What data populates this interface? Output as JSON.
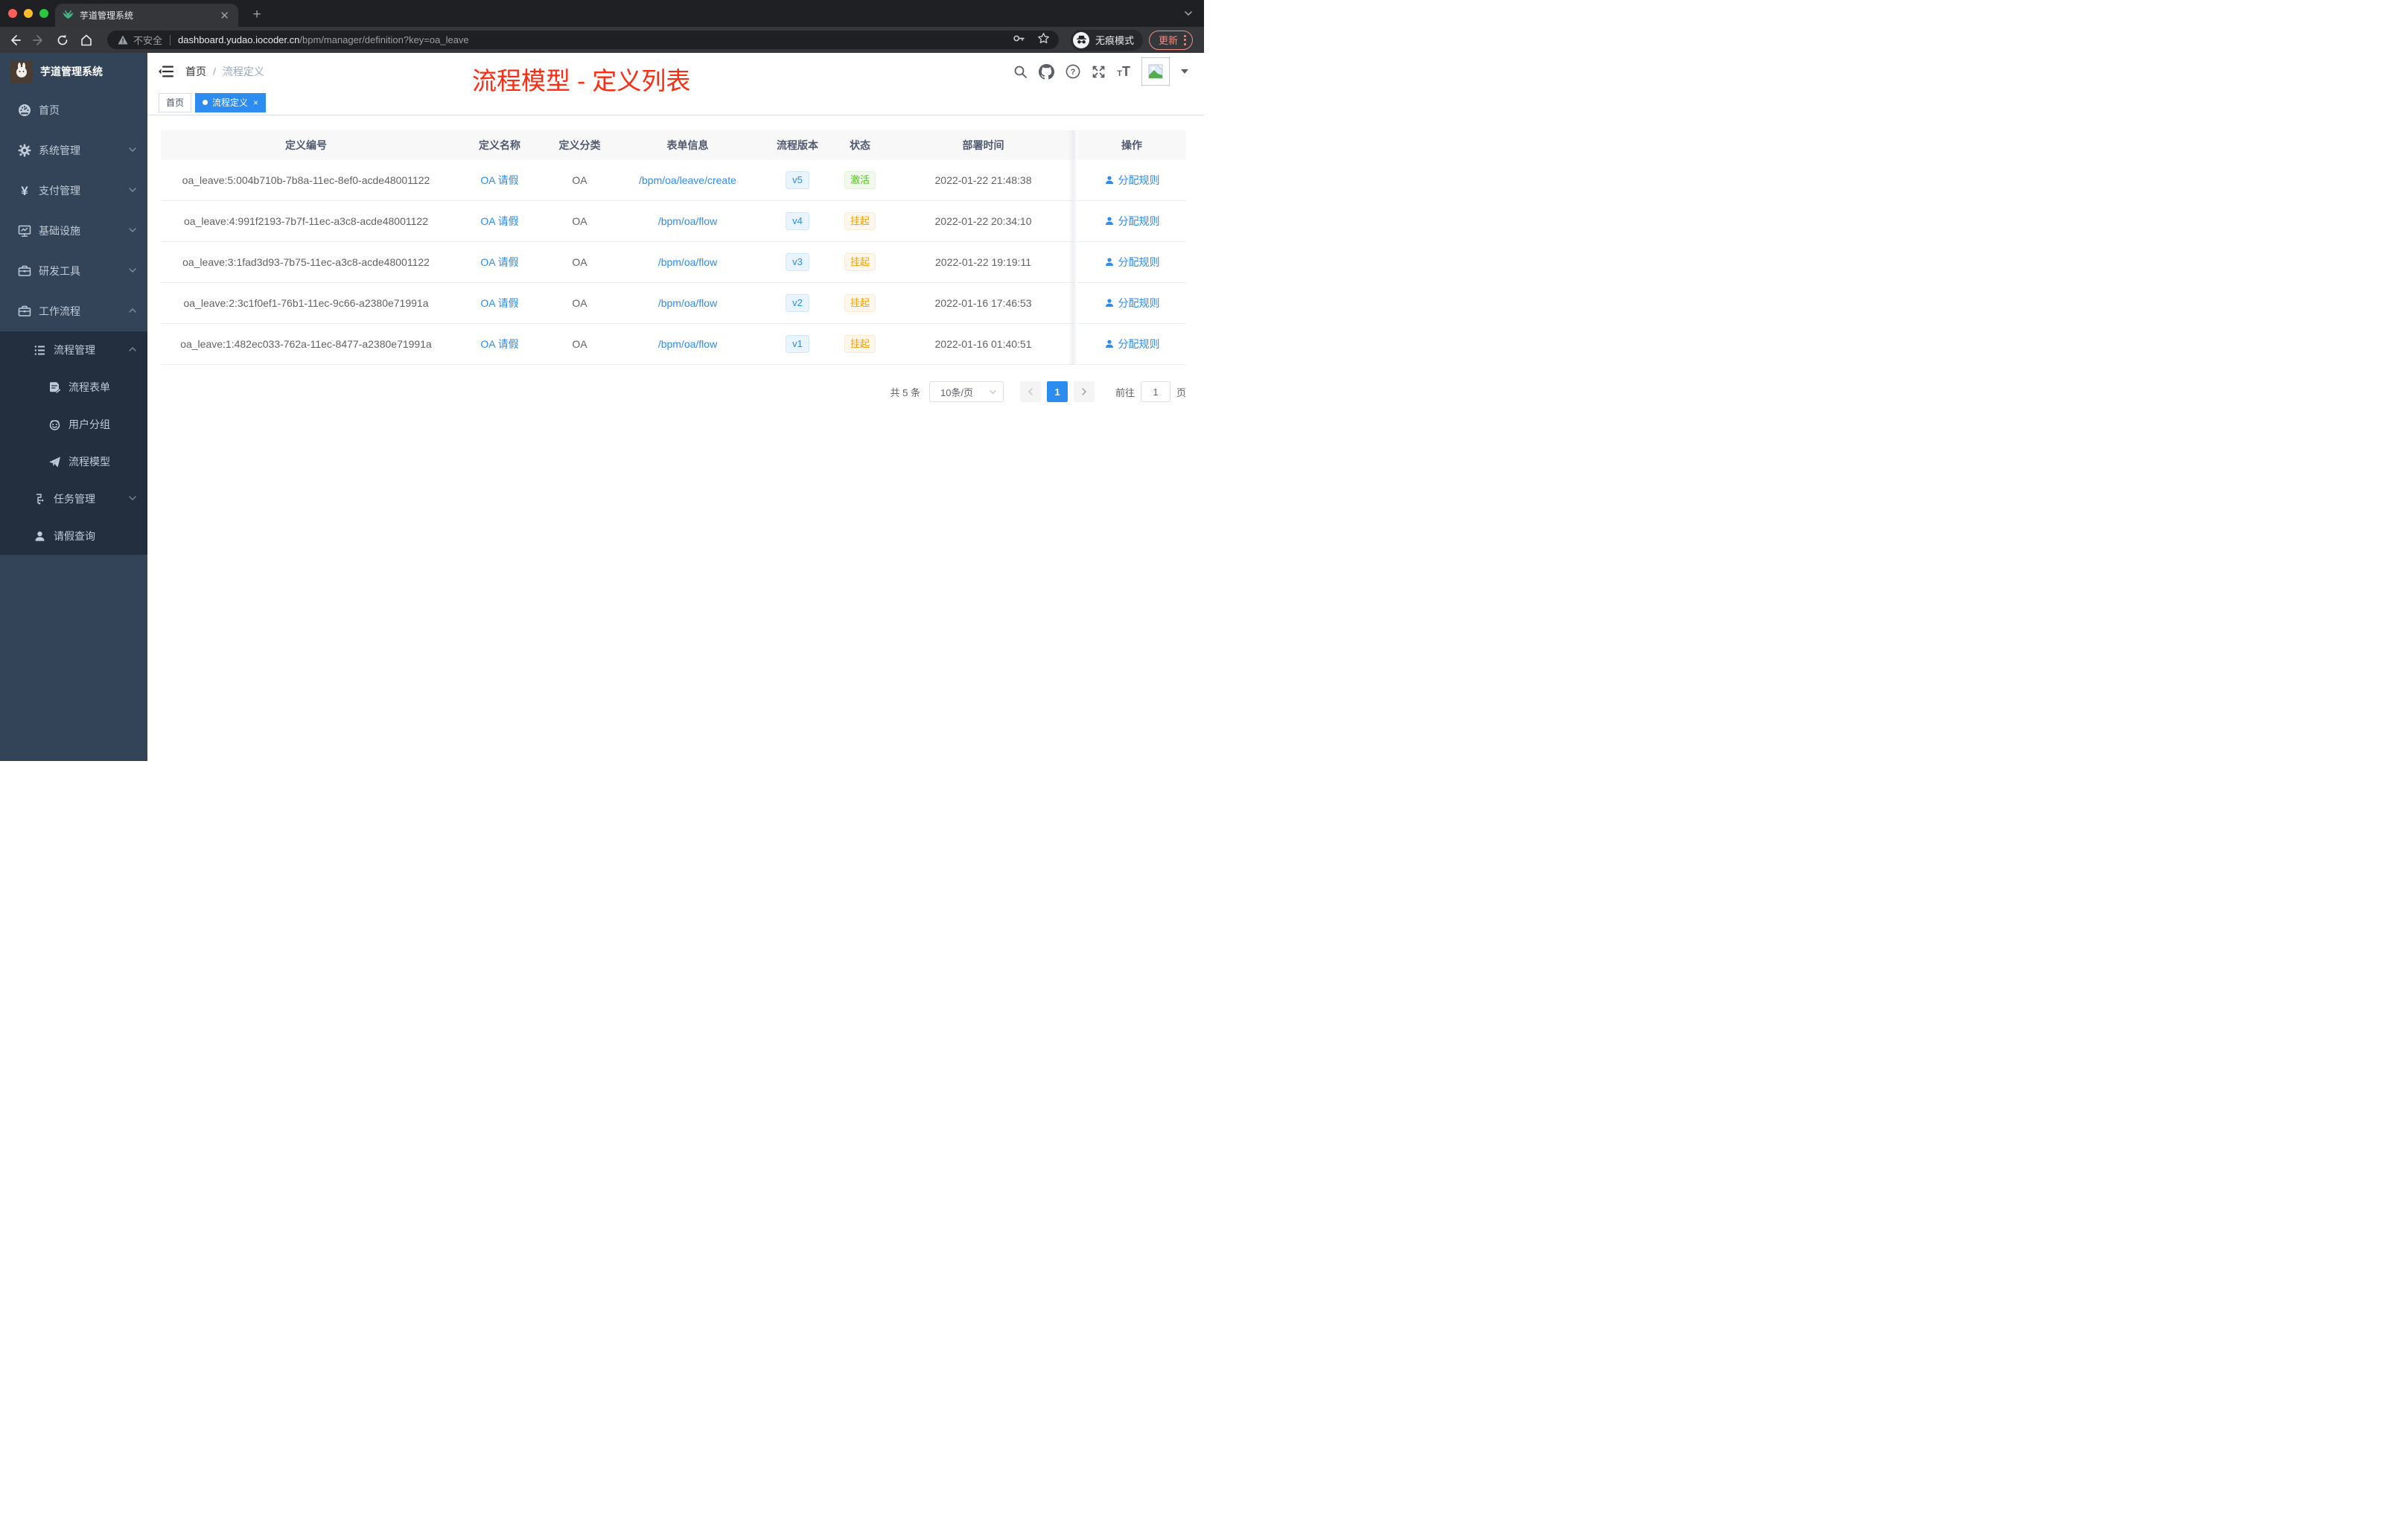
{
  "browser": {
    "tab_title": "芋道管理系统",
    "security_label": "不安全",
    "url_domain": "dashboard.yudao.iocoder.cn",
    "url_path": "/bpm/manager/definition?key=oa_leave",
    "incognito_label": "无痕模式",
    "update_label": "更新"
  },
  "annotation": {
    "title": "流程模型 - 定义列表",
    "color": "#fb2c12"
  },
  "sidebar": {
    "app_title": "芋道管理系统",
    "menu": [
      {
        "label": "首页",
        "icon": "dashboard-icon"
      },
      {
        "label": "系统管理",
        "icon": "gear-icon",
        "chevron": "down"
      },
      {
        "label": "支付管理",
        "icon": "yen-icon",
        "chevron": "down"
      },
      {
        "label": "基础设施",
        "icon": "monitor-icon",
        "chevron": "down"
      },
      {
        "label": "研发工具",
        "icon": "toolbox-icon",
        "chevron": "down"
      },
      {
        "label": "工作流程",
        "icon": "briefcase-icon",
        "chevron": "up"
      }
    ],
    "submenu": [
      {
        "label": "流程管理",
        "icon": "tree-list-icon",
        "chevron": "up"
      },
      {
        "label": "流程表单",
        "icon": "form-edit-icon"
      },
      {
        "label": "用户分组",
        "icon": "people-icon"
      },
      {
        "label": "流程模型",
        "icon": "paper-plane-icon"
      },
      {
        "label": "任务管理",
        "icon": "org-icon",
        "chevron": "down"
      },
      {
        "label": "请假查询",
        "icon": "person-icon"
      }
    ]
  },
  "header": {
    "breadcrumb": {
      "home": "首页",
      "separator": "/",
      "current": "流程定义"
    }
  },
  "tags": {
    "home": "首页",
    "active": "流程定义"
  },
  "table": {
    "columns": [
      "定义编号",
      "定义名称",
      "定义分类",
      "表单信息",
      "流程版本",
      "状态",
      "部署时间",
      "操作"
    ],
    "action_label": "分配规则",
    "rows": [
      {
        "id": "oa_leave:5:004b710b-7b8a-11ec-8ef0-acde48001122",
        "name": "OA 请假",
        "category": "OA",
        "form": "/bpm/oa/leave/create",
        "version": "v5",
        "status": "激活",
        "status_type": "success",
        "deploy_time": "2022-01-22 21:48:38"
      },
      {
        "id": "oa_leave:4:991f2193-7b7f-11ec-a3c8-acde48001122",
        "name": "OA 请假",
        "category": "OA",
        "form": "/bpm/oa/flow",
        "version": "v4",
        "status": "挂起",
        "status_type": "warning",
        "deploy_time": "2022-01-22 20:34:10"
      },
      {
        "id": "oa_leave:3:1fad3d93-7b75-11ec-a3c8-acde48001122",
        "name": "OA 请假",
        "category": "OA",
        "form": "/bpm/oa/flow",
        "version": "v3",
        "status": "挂起",
        "status_type": "warning",
        "deploy_time": "2022-01-22 19:19:11"
      },
      {
        "id": "oa_leave:2:3c1f0ef1-76b1-11ec-9c66-a2380e71991a",
        "name": "OA 请假",
        "category": "OA",
        "form": "/bpm/oa/flow",
        "version": "v2",
        "status": "挂起",
        "status_type": "warning",
        "deploy_time": "2022-01-16 17:46:53"
      },
      {
        "id": "oa_leave:1:482ec033-762a-11ec-8477-a2380e71991a",
        "name": "OA 请假",
        "category": "OA",
        "form": "/bpm/oa/flow",
        "version": "v1",
        "status": "挂起",
        "status_type": "warning",
        "deploy_time": "2022-01-16 01:40:51"
      }
    ]
  },
  "pagination": {
    "total": "共 5 条",
    "page_size": "10条/页",
    "current_page": "1",
    "goto_label": "前往",
    "goto_value": "1",
    "page_label": "页"
  },
  "colors": {
    "primary": "#2d8cf0",
    "success": "#52c41a",
    "warning": "#efa213",
    "annotation_red": "#fb2c12",
    "sidebar_bg": "#344458",
    "submenu_bg": "#232f3f",
    "chrome_bg": "#1f2023"
  }
}
